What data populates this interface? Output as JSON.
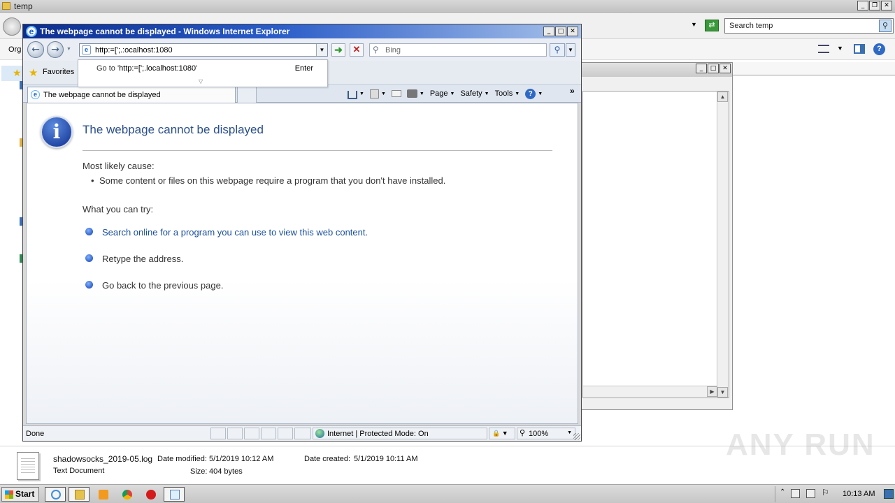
{
  "explorer": {
    "title": "temp",
    "search_placeholder": "Search temp",
    "organize_label": "Org",
    "details": {
      "file_name": "shadowsocks_2019-05.log",
      "file_type": "Text Document",
      "date_modified_label": "Date modified:",
      "date_modified": "5/1/2019 10:12 AM",
      "date_created_label": "Date created:",
      "date_created": "5/1/2019 10:11 AM",
      "size_label": "Size:",
      "size": "404 bytes"
    }
  },
  "ie": {
    "window_title": "The webpage cannot be displayed - Windows Internet Explorer",
    "address": "http:=[';.:ocalhost:1080",
    "search_placeholder": "Bing",
    "favorites_label": "Favorites",
    "autocomplete": {
      "goto_prefix": "Go to '",
      "goto_url": "http:=[';.localhost:1080",
      "goto_suffix": "'",
      "enter_label": "Enter"
    },
    "tab_label": "The webpage cannot be displayed",
    "commands": {
      "page": "Page",
      "safety": "Safety",
      "tools": "Tools"
    },
    "content": {
      "heading": "The webpage cannot be displayed",
      "cause_heading": "Most likely cause:",
      "cause_item": "Some content or files on this webpage require a program that you don't have installed.",
      "try_heading": "What you can try:",
      "try_items": [
        "Search online for a program you can use to view this web content.",
        "Retype the address.",
        "Go back to the previous page."
      ]
    },
    "status": {
      "text": "Done",
      "zone": "Internet | Protected Mode: On",
      "zoom": "100%"
    }
  },
  "taskbar": {
    "start_label": "Start",
    "clock": "10:13 AM"
  },
  "watermark": "ANY RUN"
}
